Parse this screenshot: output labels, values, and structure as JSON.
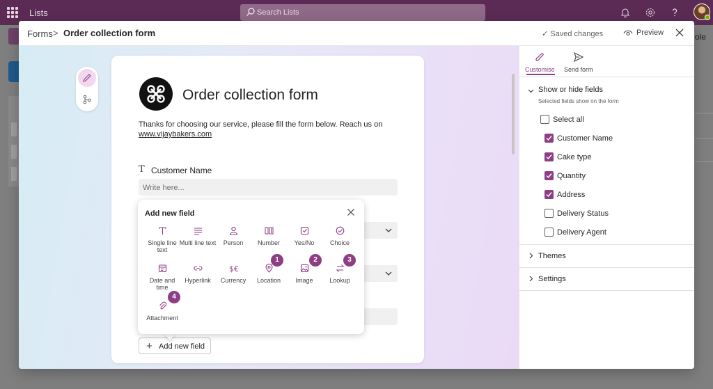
{
  "suite": {
    "app_name": "Lists",
    "search_placeholder": "Search Lists",
    "icons": [
      "waffle-icon",
      "search-icon",
      "bell-icon",
      "gear-icon",
      "help-icon",
      "avatar"
    ]
  },
  "background": {
    "right_text": "ole"
  },
  "header": {
    "breadcrumb_root": "Forms",
    "breadcrumb_separator": ">",
    "breadcrumb_current": "Order collection form",
    "saved_status": "✓ Saved changes",
    "preview_label": "Preview"
  },
  "form": {
    "title": "Order collection form",
    "description": "Thanks for choosing our service, please fill the form below. Reach us on",
    "link_text": "www.vijaybakers.com",
    "field_type_glyph": "T",
    "fields": [
      {
        "label": "Customer Name",
        "placeholder": "Write here..."
      }
    ],
    "add_field_label": "Add new field"
  },
  "add_field_popover": {
    "title": "Add new field",
    "options": [
      {
        "label": "Single line text",
        "icon": "text-icon"
      },
      {
        "label": "Multi line text",
        "icon": "multiline-icon"
      },
      {
        "label": "Person",
        "icon": "person-icon"
      },
      {
        "label": "Number",
        "icon": "number-icon"
      },
      {
        "label": "Yes/No",
        "icon": "checkbox-icon"
      },
      {
        "label": "Choice",
        "icon": "choice-icon"
      },
      {
        "label": "Date and time",
        "icon": "calendar-icon"
      },
      {
        "label": "Hyperlink",
        "icon": "link-icon"
      },
      {
        "label": "Currency",
        "icon": "currency-icon"
      },
      {
        "label": "Location",
        "icon": "location-icon",
        "badge": "1"
      },
      {
        "label": "Image",
        "icon": "image-icon",
        "badge": "2"
      },
      {
        "label": "Lookup",
        "icon": "lookup-icon",
        "badge": "3"
      },
      {
        "label": "Attachment",
        "icon": "attachment-icon",
        "badge": "4"
      }
    ]
  },
  "pane": {
    "tabs": [
      {
        "label": "Customise",
        "active": true
      },
      {
        "label": "Send form",
        "active": false
      }
    ],
    "show_hide": {
      "title": "Show or hide fields",
      "subtitle": "Selected fields show on the form",
      "select_all": {
        "label": "Select all",
        "checked": false
      },
      "fields": [
        {
          "label": "Customer Name",
          "checked": true
        },
        {
          "label": "Cake type",
          "checked": true
        },
        {
          "label": "Quantity",
          "checked": true
        },
        {
          "label": "Address",
          "checked": true
        },
        {
          "label": "Delivery Status",
          "checked": false
        },
        {
          "label": "Delivery Agent",
          "checked": false
        }
      ]
    },
    "sections": [
      {
        "title": "Themes"
      },
      {
        "title": "Settings"
      }
    ]
  },
  "colors": {
    "suite_bar": "#5c2b55",
    "accent": "#8e3e84",
    "badge": "#8e3e84"
  }
}
